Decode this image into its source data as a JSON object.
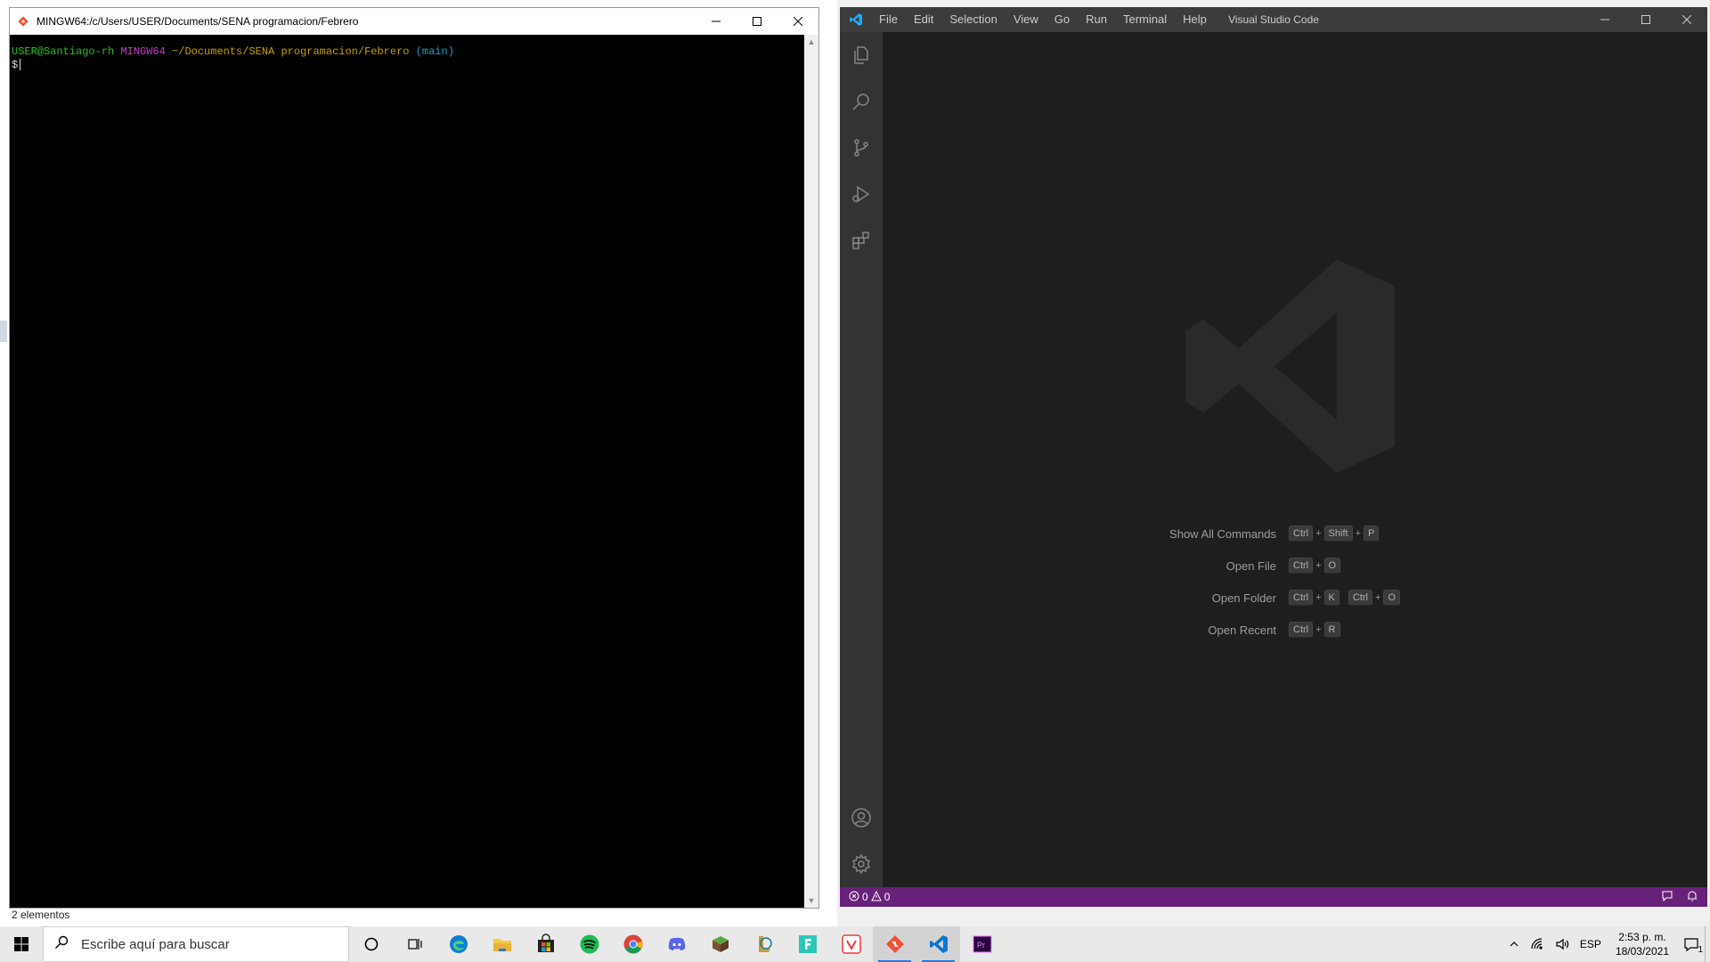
{
  "explorer": {
    "status_text": "2 elementos"
  },
  "bash": {
    "title": "MINGW64:/c/Users/USER/Documents/SENA programacion/Febrero",
    "prompt_user": "USER@Santiago-rh",
    "prompt_system": "MINGW64",
    "prompt_path": "~/Documents/SENA programacion/Febrero",
    "prompt_branch": "(main)",
    "prompt_symbol": "$"
  },
  "vscode": {
    "title": "Visual Studio Code",
    "menu": [
      "File",
      "Edit",
      "Selection",
      "View",
      "Go",
      "Run",
      "Terminal",
      "Help"
    ],
    "shortcuts": [
      {
        "label": "Show All Commands",
        "keys": [
          [
            "Ctrl",
            "Shift",
            "P"
          ]
        ]
      },
      {
        "label": "Open File",
        "keys": [
          [
            "Ctrl",
            "O"
          ]
        ]
      },
      {
        "label": "Open Folder",
        "keys": [
          [
            "Ctrl",
            "K"
          ],
          [
            "Ctrl",
            "O"
          ]
        ]
      },
      {
        "label": "Open Recent",
        "keys": [
          [
            "Ctrl",
            "R"
          ]
        ]
      }
    ],
    "plus": "+",
    "status": {
      "errors": "0",
      "warnings": "0"
    },
    "accent_status": "#68217a"
  },
  "taskbar": {
    "search_placeholder": "Escribe aquí para buscar",
    "language": "ESP",
    "time": "2:53 p. m.",
    "date": "18/03/2021",
    "notifications": "1"
  }
}
